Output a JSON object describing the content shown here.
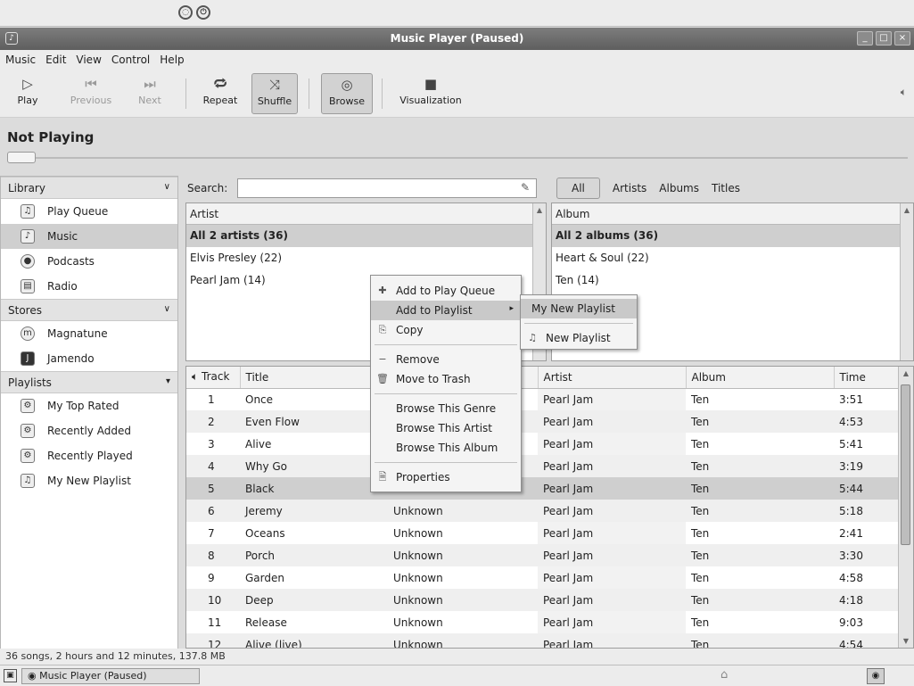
{
  "window": {
    "title": "Music Player (Paused)"
  },
  "menubar": [
    "Music",
    "Edit",
    "View",
    "Control",
    "Help"
  ],
  "toolbar": {
    "play": "Play",
    "previous": "Previous",
    "next": "Next",
    "repeat": "Repeat",
    "shuffle": "Shuffle",
    "browse": "Browse",
    "visualization": "Visualization"
  },
  "now_playing": "Not Playing",
  "sidebar": {
    "library_header": "Library",
    "library": [
      "Play Queue",
      "Music",
      "Podcasts",
      "Radio"
    ],
    "stores_header": "Stores",
    "stores": [
      "Magnatune",
      "Jamendo"
    ],
    "playlists_header": "Playlists",
    "playlists": [
      "My Top Rated",
      "Recently Added",
      "Recently Played",
      "My New Playlist"
    ]
  },
  "search": {
    "label": "Search:",
    "value": ""
  },
  "filters": {
    "all": "All",
    "artists": "Artists",
    "albums": "Albums",
    "titles": "Titles"
  },
  "artist_pane": {
    "header": "Artist",
    "rows": [
      "All 2 artists (36)",
      "Elvis Presley (22)",
      "Pearl Jam (14)"
    ]
  },
  "album_pane": {
    "header": "Album",
    "rows": [
      "All 2 albums (36)",
      "Heart & Soul (22)",
      "Ten (14)"
    ]
  },
  "tracks": {
    "headers": {
      "track": "Track",
      "title": "Title",
      "genre": "",
      "artist": "Artist",
      "album": "Album",
      "time": "Time"
    },
    "rows": [
      {
        "track": "1",
        "title": "Once",
        "genre": "",
        "artist": "Pearl Jam",
        "album": "Ten",
        "time": "3:51"
      },
      {
        "track": "2",
        "title": "Even Flow",
        "genre": "",
        "artist": "Pearl Jam",
        "album": "Ten",
        "time": "4:53"
      },
      {
        "track": "3",
        "title": "Alive",
        "genre": "",
        "artist": "Pearl Jam",
        "album": "Ten",
        "time": "5:41"
      },
      {
        "track": "4",
        "title": "Why Go",
        "genre": "",
        "artist": "Pearl Jam",
        "album": "Ten",
        "time": "3:19"
      },
      {
        "track": "5",
        "title": "Black",
        "genre": "",
        "artist": "Pearl Jam",
        "album": "Ten",
        "time": "5:44"
      },
      {
        "track": "6",
        "title": "Jeremy",
        "genre": "Unknown",
        "artist": "Pearl Jam",
        "album": "Ten",
        "time": "5:18"
      },
      {
        "track": "7",
        "title": "Oceans",
        "genre": "Unknown",
        "artist": "Pearl Jam",
        "album": "Ten",
        "time": "2:41"
      },
      {
        "track": "8",
        "title": "Porch",
        "genre": "Unknown",
        "artist": "Pearl Jam",
        "album": "Ten",
        "time": "3:30"
      },
      {
        "track": "9",
        "title": "Garden",
        "genre": "Unknown",
        "artist": "Pearl Jam",
        "album": "Ten",
        "time": "4:58"
      },
      {
        "track": "10",
        "title": "Deep",
        "genre": "Unknown",
        "artist": "Pearl Jam",
        "album": "Ten",
        "time": "4:18"
      },
      {
        "track": "11",
        "title": "Release",
        "genre": "Unknown",
        "artist": "Pearl Jam",
        "album": "Ten",
        "time": "9:03"
      },
      {
        "track": "12",
        "title": "Alive (live)",
        "genre": "Unknown",
        "artist": "Pearl Jam",
        "album": "Ten",
        "time": "4:54"
      }
    ]
  },
  "context_menu": {
    "add_to_queue": "Add to Play Queue",
    "add_to_playlist": "Add to Playlist",
    "copy": "Copy",
    "remove": "Remove",
    "move_to_trash": "Move to Trash",
    "browse_genre": "Browse This Genre",
    "browse_artist": "Browse This Artist",
    "browse_album": "Browse This Album",
    "properties": "Properties"
  },
  "submenu": {
    "my_new_playlist": "My New Playlist",
    "new_playlist": "New Playlist"
  },
  "status": "36 songs, 2 hours and 12 minutes, 137.8 MB",
  "taskbar": {
    "task": "Music Player (Paused)"
  }
}
